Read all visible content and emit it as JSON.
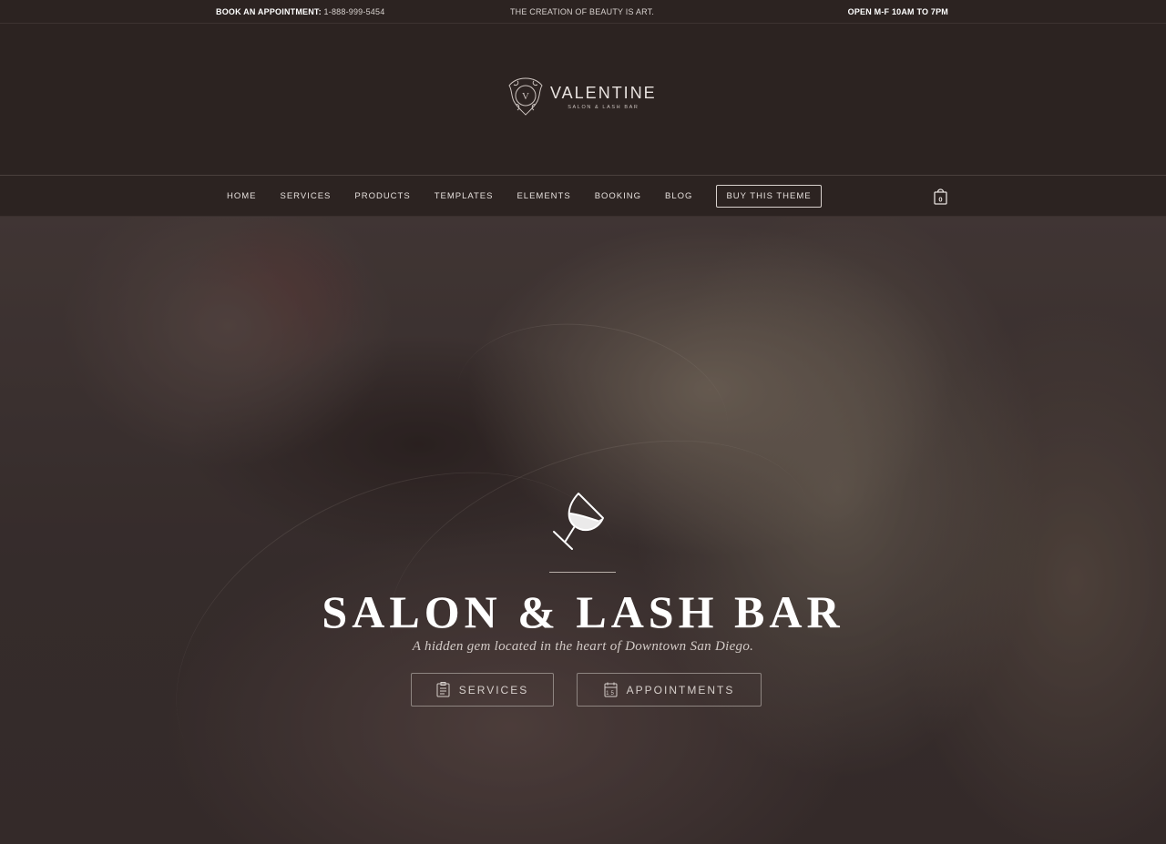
{
  "topbar": {
    "book_label": "BOOK AN APPOINTMENT:",
    "phone": "1-888-999-5454",
    "tagline": "THE CREATION OF BEAUTY IS ART.",
    "hours": "OPEN M-F 10AM TO 7PM"
  },
  "logo": {
    "name": "VALENTINE",
    "tag": "SALON & LASH BAR",
    "monogram": "V"
  },
  "nav": {
    "items": [
      "HOME",
      "SERVICES",
      "PRODUCTS",
      "TEMPLATES",
      "ELEMENTS",
      "BOOKING",
      "BLOG"
    ],
    "buy_label": "BUY THIS THEME",
    "cart_count": "0"
  },
  "hero": {
    "icon": "wine-glass-icon",
    "title": "SALON & LASH BAR",
    "subtitle": "A hidden gem located in the heart of Downtown San Diego.",
    "buttons": {
      "services": {
        "label": "SERVICES",
        "icon": "clipboard-icon"
      },
      "appointments": {
        "label": "APPOINTMENTS",
        "icon": "calendar-icon",
        "icon_text": "15"
      }
    }
  },
  "colors": {
    "background": "#2c2321",
    "text": "#ffffff",
    "muted": "#d3cbc7"
  }
}
